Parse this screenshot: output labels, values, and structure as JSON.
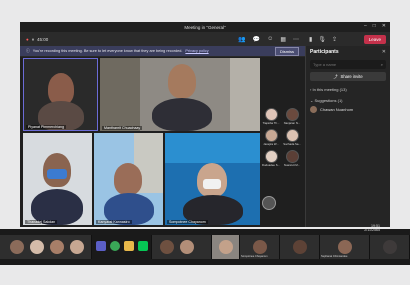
{
  "window": {
    "title": "Meeting in \"General\"",
    "timer": "45:00"
  },
  "controls": {
    "leave_label": "Leave"
  },
  "banner": {
    "text": "You're recording this meeting. Be sure to let everyone know that they are being recorded.",
    "privacy_label": "Privacy policy",
    "dismiss_label": "Dismiss"
  },
  "video_tiles": [
    {
      "name": "Piyanat Pimmerchiang"
    },
    {
      "name": "Manthanrit Chuachaay"
    },
    {
      "name": "Thanadej Sakdan"
    },
    {
      "name": "Kanyarat Kannasiro"
    },
    {
      "name": "Sompotnee Chayanom"
    }
  ],
  "gallery": [
    {
      "name": "Tiapsiba Th..."
    },
    {
      "name": "Nanjaran N..."
    },
    {
      "name": "Janejira W..."
    },
    {
      "name": "Suchada Sa..."
    },
    {
      "name": "Duduadee S..."
    },
    {
      "name": "Nuanrutt M..."
    }
  ],
  "participants_panel": {
    "title": "Participants",
    "search_placeholder": "Type a name",
    "share_invite_label": "Share invite",
    "in_meeting_label": "In this meeting (13)",
    "suggestions_label": "Suggestions (1)",
    "suggested_member": "Chawan Nuanhom"
  },
  "taskbar": {
    "time": "19:51",
    "date": "2/11/2565"
  },
  "strip": [
    {
      "name": ""
    },
    {
      "name": ""
    },
    {
      "name": ""
    },
    {
      "name": "Sompotnee Chayanom"
    },
    {
      "name": ""
    },
    {
      "name": "Suphanat Chimcandee"
    },
    {
      "name": ""
    }
  ]
}
